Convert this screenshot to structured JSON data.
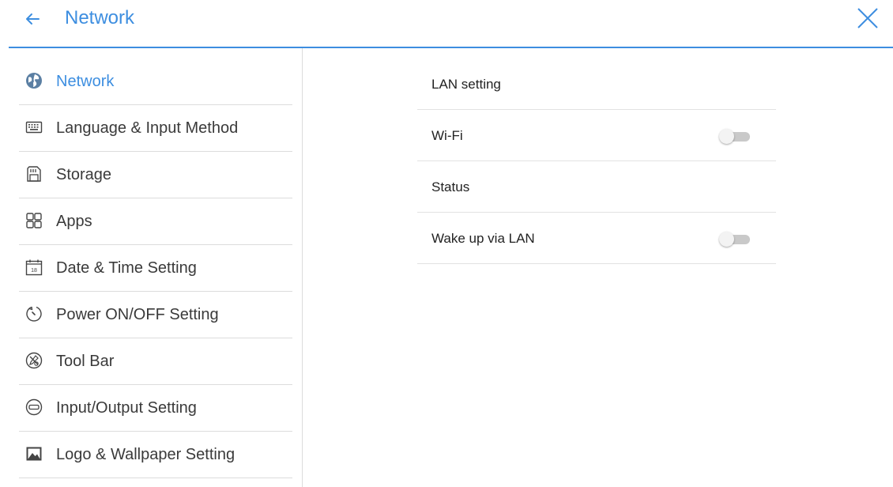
{
  "header": {
    "title": "Network",
    "back_icon": "arrow-left-icon",
    "close_icon": "close-icon",
    "accent_color": "#3d8ee0"
  },
  "sidebar": {
    "items": [
      {
        "label": "Network",
        "icon": "globe-icon",
        "active": true
      },
      {
        "label": "Language & Input Method",
        "icon": "keyboard-icon",
        "active": false
      },
      {
        "label": "Storage",
        "icon": "sd-card-icon",
        "active": false
      },
      {
        "label": "Apps",
        "icon": "apps-grid-icon",
        "active": false
      },
      {
        "label": "Date & Time Setting",
        "icon": "calendar-icon",
        "active": false,
        "icon_text": "18"
      },
      {
        "label": "Power ON/OFF Setting",
        "icon": "timer-icon",
        "active": false
      },
      {
        "label": "Tool Bar",
        "icon": "toolbar-icon",
        "active": false
      },
      {
        "label": "Input/Output Setting",
        "icon": "io-port-icon",
        "active": false
      },
      {
        "label": "Logo & Wallpaper Setting",
        "icon": "image-icon",
        "active": false
      }
    ]
  },
  "content": {
    "rows": [
      {
        "label": "LAN setting"
      },
      {
        "label": "Wi-Fi",
        "toggle": false
      },
      {
        "label": "Status"
      },
      {
        "label": "Wake up via LAN",
        "toggle": false
      }
    ]
  }
}
